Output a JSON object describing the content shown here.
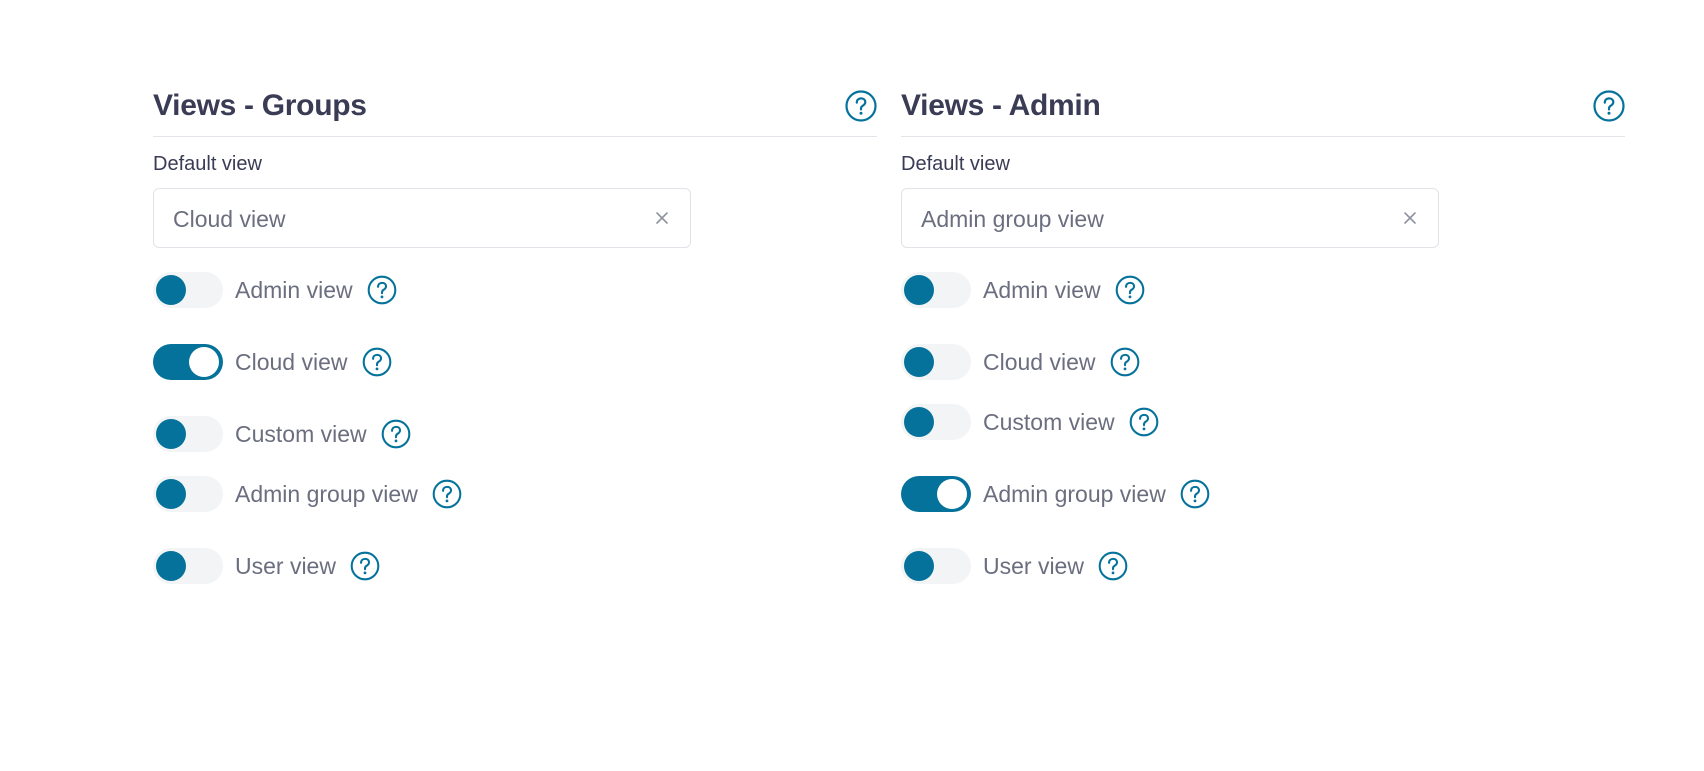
{
  "colors": {
    "accent": "#05729b",
    "switch_off_track": "#f3f4f6",
    "title_text": "#3a3c55",
    "body_text": "#6b6e7f",
    "divider": "#e3e5ea"
  },
  "icons": {
    "help": "help-circle-icon",
    "clear": "close-icon"
  },
  "panels": [
    {
      "title": "Views - Groups",
      "default_view_label": "Default view",
      "default_view_value": "Cloud view",
      "toggles": [
        {
          "label": "Admin view",
          "checked": false
        },
        {
          "label": "Cloud view",
          "checked": true
        },
        {
          "label": "Custom view",
          "checked": false
        },
        {
          "label": "Admin group view",
          "checked": false
        },
        {
          "label": "User view",
          "checked": false
        }
      ]
    },
    {
      "title": "Views - Admin",
      "default_view_label": "Default view",
      "default_view_value": "Admin group view",
      "toggles": [
        {
          "label": "Admin view",
          "checked": false
        },
        {
          "label": "Cloud view",
          "checked": false
        },
        {
          "label": "Custom view",
          "checked": false
        },
        {
          "label": "Admin group view",
          "checked": true
        },
        {
          "label": "User view",
          "checked": false
        }
      ]
    }
  ]
}
